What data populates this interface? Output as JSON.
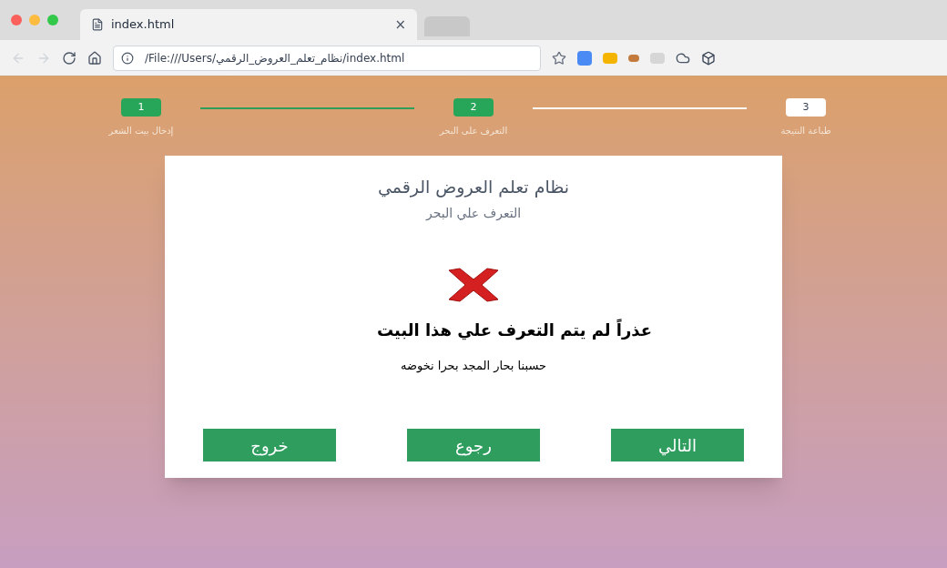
{
  "browser": {
    "tab_title": "index.html",
    "tab_close": "×",
    "address": "/File:///Users/نظام_تعلم_العروض_الرقمي/index.html"
  },
  "steps": [
    {
      "number": "3",
      "label": "طباعة النتيجة",
      "done": false
    },
    {
      "number": "2",
      "label": "التعرف على البحر",
      "done": true
    },
    {
      "number": "1",
      "label": "إدخال بيت الشعر",
      "done": true
    }
  ],
  "card": {
    "title": "نظام تعلم العروض الرقمي",
    "subtitle": "التعرف علي البحر",
    "message": "عذراً لم يتم التعرف علي هذا البيت",
    "verse": "حسبنا بحار المجد بحرا نخوضه"
  },
  "buttons": [
    "التالي",
    "رجوع",
    "خروج"
  ]
}
